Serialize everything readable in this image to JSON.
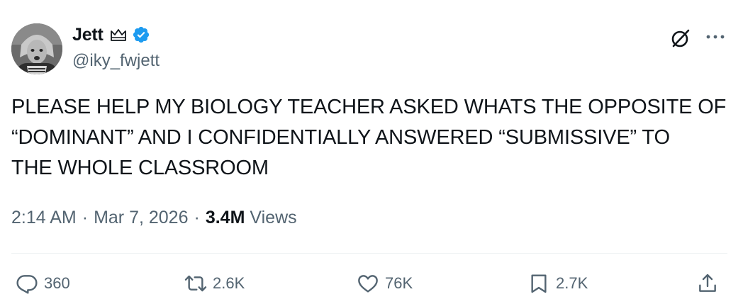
{
  "author": {
    "display_name": "Jett",
    "handle": "@iky_fwjett"
  },
  "tweet": {
    "text": "PLEASE HELP MY BIOLOGY TEACHER ASKED WHATS THE OPPOSITE OF\n“DOMINANT” AND I CONFIDENTIALLY ANSWERED “SUBMISSIVE” TO\nTHE WHOLE CLASSROOM"
  },
  "meta": {
    "time": "2:14 AM",
    "separator": "·",
    "date": "Mar 7, 2026",
    "views_count": "3.4M",
    "views_label": "Views"
  },
  "actions": {
    "replies": "360",
    "reposts": "2.6K",
    "likes": "76K",
    "bookmarks": "2.7K"
  },
  "colors": {
    "text_primary": "#0f1419",
    "text_secondary": "#536471",
    "verified_blue": "#1d9bf0",
    "divider": "#eff3f4"
  },
  "icons": [
    "crown-icon",
    "verified-badge-icon",
    "grok-icon",
    "more-icon",
    "reply-icon",
    "repost-icon",
    "like-icon",
    "bookmark-icon",
    "share-icon"
  ]
}
